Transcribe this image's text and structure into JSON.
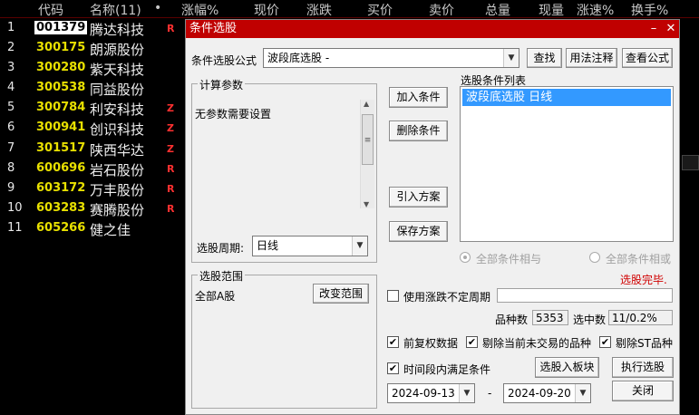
{
  "table": {
    "headers": [
      "代码",
      "名称(11)",
      "•",
      "涨幅%",
      "现价",
      "涨跌",
      "买价",
      "卖价",
      "总量",
      "现量",
      "涨速%",
      "换手%"
    ],
    "rows": [
      {
        "idx": "1",
        "code": "001379",
        "name": "腾达科技",
        "flag": "R"
      },
      {
        "idx": "2",
        "code": "300175",
        "name": "朗源股份",
        "flag": ""
      },
      {
        "idx": "3",
        "code": "300280",
        "name": "紫天科技",
        "flag": ""
      },
      {
        "idx": "4",
        "code": "300538",
        "name": "同益股份",
        "flag": ""
      },
      {
        "idx": "5",
        "code": "300784",
        "name": "利安科技",
        "flag": "Z"
      },
      {
        "idx": "6",
        "code": "300941",
        "name": "创识科技",
        "flag": "Z"
      },
      {
        "idx": "7",
        "code": "301517",
        "name": "陕西华达",
        "flag": "Z"
      },
      {
        "idx": "8",
        "code": "600696",
        "name": "岩石股份",
        "flag": "R"
      },
      {
        "idx": "9",
        "code": "603172",
        "name": "万丰股份",
        "flag": "R"
      },
      {
        "idx": "10",
        "code": "603283",
        "name": "赛腾股份",
        "flag": "R"
      },
      {
        "idx": "11",
        "code": "605266",
        "name": "健之佳",
        "flag": ""
      }
    ]
  },
  "dialog": {
    "title": "条件选股",
    "formula_label": "条件选股公式",
    "formula_value": "波段底选股   -",
    "find_button": "查找",
    "usage_button": "用法注释",
    "view_formula_button": "查看公式",
    "params_group": "计算参数",
    "params_text": "无参数需要设置",
    "period_label": "选股周期:",
    "period_value": "日线",
    "add_condition": "加入条件",
    "delete_condition": "删除条件",
    "import_plan": "引入方案",
    "save_plan": "保存方案",
    "condition_list_label": "选股条件列表",
    "condition_list": [
      "波段底选股  日线"
    ],
    "radio_and": "全部条件相与",
    "radio_or": "全部条件相或",
    "status_text": "选股完毕.",
    "range_group": "选股范围",
    "range_value": "全部A股",
    "change_range": "改变范围",
    "use_uncertain_period": "使用涨跌不定周期",
    "stock_count_label": "品种数",
    "stock_count": "5353",
    "selected_label": "选中数",
    "selected_value": "11/0.2%",
    "forward_adjust": "前复权数据",
    "exclude_untraded": "剔除当前未交易的品种",
    "exclude_st": "剔除ST品种",
    "time_period": "时间段内满足条件",
    "to_block": "选股入板块",
    "execute": "执行选股",
    "date_from": "2024-09-13",
    "date_sep": "-",
    "date_to": "2024-09-20",
    "close": "关闭",
    "accent": "#c00000"
  }
}
